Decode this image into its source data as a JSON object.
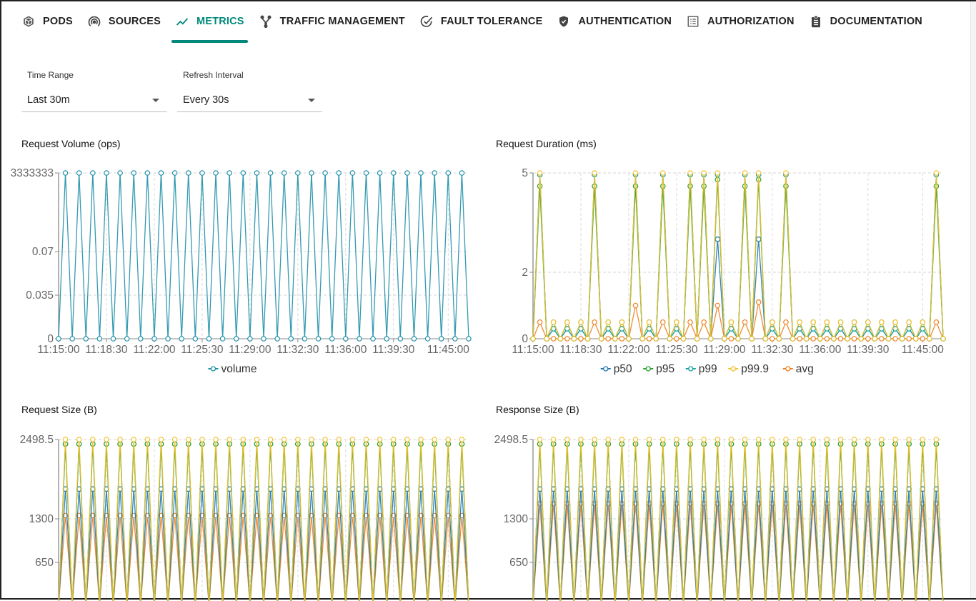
{
  "tabs": [
    {
      "label": "PODS",
      "icon": "cube-icon",
      "active": false
    },
    {
      "label": "SOURCES",
      "icon": "broadcast-icon",
      "active": false
    },
    {
      "label": "METRICS",
      "icon": "trending-icon",
      "active": true
    },
    {
      "label": "TRAFFIC MANAGEMENT",
      "icon": "fork-icon",
      "active": false
    },
    {
      "label": "FAULT TOLERANCE",
      "icon": "check-circle-icon",
      "active": false
    },
    {
      "label": "AUTHENTICATION",
      "icon": "shield-icon",
      "active": false
    },
    {
      "label": "AUTHORIZATION",
      "icon": "list-icon",
      "active": false
    },
    {
      "label": "DOCUMENTATION",
      "icon": "clipboard-icon",
      "active": false
    }
  ],
  "accent_color": "#00897b",
  "filters": {
    "time_range": {
      "label": "Time Range",
      "value": "Last 30m"
    },
    "refresh_interval": {
      "label": "Refresh Interval",
      "value": "Every 30s"
    }
  },
  "series_colors": {
    "volume": "#1f8fa8",
    "p50": "#1f77b4",
    "p95": "#2ca02c",
    "p99": "#17a2a0",
    "p99.9": "#f2c12e",
    "avg": "#f07f1e"
  },
  "chart_data": [
    {
      "id": "request-volume",
      "type": "line",
      "title": "Request Volume (ops)",
      "xlabel": "",
      "ylabel": "",
      "x_start": "11:15:00",
      "x_step_seconds": 30,
      "x_count": 61,
      "x_ticks": [
        "11:15:00",
        "11:18:30",
        "11:22:00",
        "11:25:30",
        "11:29:00",
        "11:32:30",
        "11:36:00",
        "11:39:30",
        "11:45:00"
      ],
      "y_ticks": [
        "0",
        "0.035",
        "0.07",
        "3333333"
      ],
      "grid": true,
      "legend": "bottom-center",
      "series": [
        {
          "name": "volume",
          "pattern": "alternating",
          "values_even": 0,
          "values_odd": 3333333
        }
      ]
    },
    {
      "id": "request-duration",
      "type": "line",
      "title": "Request Duration (ms)",
      "xlabel": "",
      "ylabel": "",
      "x_start": "11:15:00",
      "x_step_seconds": 30,
      "x_count": 61,
      "x_ticks": [
        "11:15:00",
        "11:18:30",
        "11:22:00",
        "11:25:30",
        "11:29:00",
        "11:32:30",
        "11:36:00",
        "11:39:30",
        "11:45:00"
      ],
      "y_ticks": [
        "0",
        "2",
        "5"
      ],
      "ylim": [
        0,
        5
      ],
      "grid": true,
      "legend": "bottom-center",
      "spikes": [
        1,
        9,
        15,
        19,
        23,
        25,
        27,
        31,
        33,
        37,
        59
      ],
      "small_peaks": [
        3,
        5,
        7,
        11,
        13,
        17,
        21,
        29,
        35,
        39,
        41,
        43,
        45,
        47,
        49,
        51,
        53,
        55,
        57
      ],
      "series": [
        {
          "name": "p50",
          "spike": 4.95,
          "spike_alt": {
            "27": 3.0,
            "33": 3.0
          },
          "small": 0.3,
          "avg_peak": 0.3
        },
        {
          "name": "p95",
          "spike": 4.6,
          "spike_alt": {
            "27": 4.8,
            "33": 4.8
          },
          "small": 0.5
        },
        {
          "name": "p99",
          "spike": 4.95,
          "small": 0.3
        },
        {
          "name": "p99.9",
          "spike": 5.0,
          "small": 0.5
        },
        {
          "name": "avg",
          "spike": 0.5,
          "spike_alt": {
            "15": 1.0,
            "27": 1.0,
            "33": 1.1
          },
          "small": 0
        }
      ]
    },
    {
      "id": "request-size",
      "type": "line",
      "title": "Request Size (B)",
      "xlabel": "",
      "ylabel": "",
      "y_ticks": [
        "650",
        "1300",
        "2498.5"
      ],
      "ylim": [
        0,
        2498.5
      ],
      "grid": true,
      "pattern": "alternating",
      "series": [
        {
          "name": "p50",
          "peak": 1750
        },
        {
          "name": "p95",
          "peak": 2430
        },
        {
          "name": "p99",
          "peak": 2430
        },
        {
          "name": "p99.9",
          "peak": 2498.5
        },
        {
          "name": "avg",
          "peak": 1350
        }
      ]
    },
    {
      "id": "response-size",
      "type": "line",
      "title": "Response Size (B)",
      "xlabel": "",
      "ylabel": "",
      "y_ticks": [
        "650",
        "1300",
        "2498.5"
      ],
      "ylim": [
        0,
        2498.5
      ],
      "grid": true,
      "pattern": "alternating",
      "series": [
        {
          "name": "p50",
          "peak": 1750
        },
        {
          "name": "p95",
          "peak": 2430
        },
        {
          "name": "p99",
          "peak": 2430
        },
        {
          "name": "p99.9",
          "peak": 2498.5
        },
        {
          "name": "avg",
          "peak": 1530
        }
      ]
    }
  ]
}
